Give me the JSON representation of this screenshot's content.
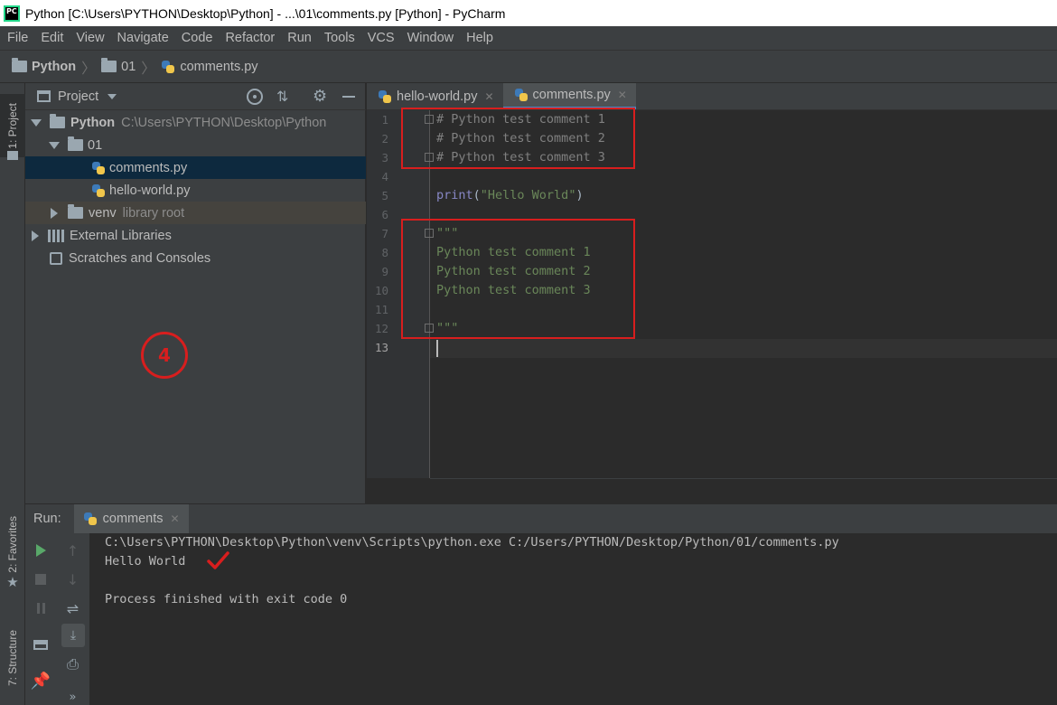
{
  "window": {
    "app_icon": "pycharm-logo",
    "title": "Python [C:\\Users\\PYTHON\\Desktop\\Python] - ...\\01\\comments.py [Python] - PyCharm"
  },
  "menu": [
    "File",
    "Edit",
    "View",
    "Navigate",
    "Code",
    "Refactor",
    "Run",
    "Tools",
    "VCS",
    "Window",
    "Help"
  ],
  "breadcrumb": [
    "Python",
    "01",
    "comments.py"
  ],
  "left_stripe": {
    "project_tab": "1: Project",
    "favorites_tab": "2: Favorites",
    "structure_tab": "7: Structure"
  },
  "project_panel": {
    "title": "Project",
    "tree": [
      {
        "label": "Python",
        "detail": "C:\\Users\\PYTHON\\Desktop\\Python",
        "icon": "folder-icon",
        "expanded": true
      },
      {
        "label": "01",
        "detail": "",
        "icon": "folder-icon",
        "expanded": true
      },
      {
        "label": "comments.py",
        "detail": "",
        "icon": "python-file-icon",
        "selected": true
      },
      {
        "label": "hello-world.py",
        "detail": "",
        "icon": "python-file-icon"
      },
      {
        "label": "venv",
        "detail": "library root",
        "icon": "folder-icon",
        "expanded": false
      },
      {
        "label": "External Libraries",
        "detail": "",
        "icon": "library-icon",
        "expanded": false
      },
      {
        "label": "Scratches and Consoles",
        "detail": "",
        "icon": "scratches-icon"
      }
    ],
    "annotation": "4"
  },
  "editor": {
    "tabs": [
      {
        "label": "hello-world.py",
        "active": false
      },
      {
        "label": "comments.py",
        "active": true
      }
    ],
    "line_numbers": [
      "1",
      "2",
      "3",
      "4",
      "5",
      "6",
      "7",
      "8",
      "9",
      "10",
      "11",
      "12",
      "13"
    ],
    "lines": [
      "# Python test comment 1",
      "# Python test comment 2",
      "# Python test comment 3",
      "",
      "print(\"Hello World\")",
      "",
      "\"\"\"",
      "Python test comment 1",
      "Python test comment 2",
      "Python test comment 3",
      "",
      "\"\"\"",
      ""
    ],
    "print_fn": "print",
    "print_open": "(",
    "print_arg": "\"Hello World\"",
    "print_close": ")",
    "highlight_color": "#d81e1e"
  },
  "run_panel": {
    "label": "Run:",
    "tab": "comments",
    "console": [
      "C:\\Users\\PYTHON\\Desktop\\Python\\venv\\Scripts\\python.exe C:/Users/PYTHON/Desktop/Python/01/comments.py",
      "Hello World",
      "",
      "Process finished with exit code 0"
    ],
    "more_label": "»"
  },
  "colors": {
    "accent": "#4a88c7",
    "annotation_red": "#d81e1e",
    "run_green": "#59a869"
  }
}
